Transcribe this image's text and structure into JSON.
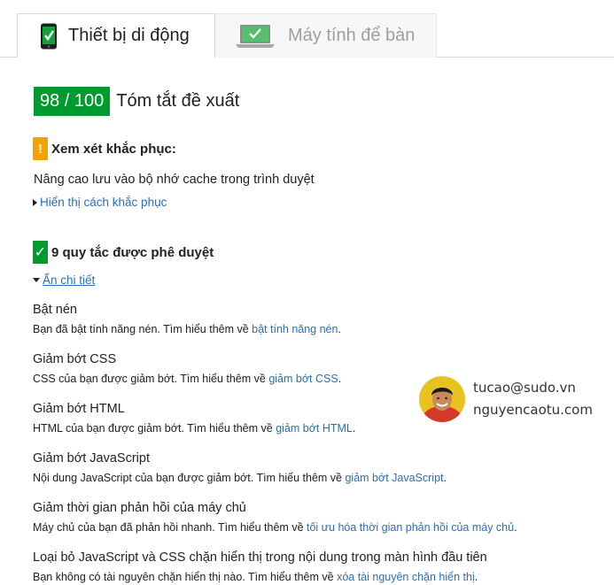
{
  "tabs": {
    "mobile": {
      "label": "Thiết bị di động",
      "icon": "mobile-phone-icon"
    },
    "desktop": {
      "label": "Máy tính để bàn",
      "icon": "laptop-icon"
    }
  },
  "summary": {
    "score": "98 / 100",
    "title": "Tóm tắt đề xuất"
  },
  "consider_fixing": {
    "badge": "!",
    "heading": "Xem xét khắc phục:",
    "item": "Nâng cao lưu vào bộ nhớ cache trong trình duyệt",
    "toggle": "Hiển thị cách khắc phục"
  },
  "passed": {
    "badge": "✓",
    "heading": "9 quy tắc được phê duyệt",
    "toggle": "Ẩn chi tiết",
    "rules": [
      {
        "title": "Bật nén",
        "desc": "Bạn đã bật tính năng nén. Tìm hiểu thêm về ",
        "link": "bật tính năng nén",
        "end": "."
      },
      {
        "title": "Giảm bớt CSS",
        "desc": "CSS của bạn được giảm bớt. Tìm hiểu thêm về ",
        "link": "giảm bớt CSS",
        "end": "."
      },
      {
        "title": "Giảm bớt HTML",
        "desc": "HTML của bạn được giảm bớt. Tìm hiểu thêm về ",
        "link": "giảm bớt HTML",
        "end": "."
      },
      {
        "title": "Giảm bớt JavaScript",
        "desc": "Nội dung JavaScript của bạn được giảm bớt. Tìm hiểu thêm về ",
        "link": "giảm bớt JavaScript",
        "end": "."
      },
      {
        "title": "Giảm thời gian phản hồi của máy chủ",
        "desc": "Máy chủ của bạn đã phản hồi nhanh. Tìm hiểu thêm về ",
        "link": "tối ưu hóa thời gian phản hồi của máy chủ",
        "end": "."
      },
      {
        "title": "Loại bỏ JavaScript và CSS chặn hiển thị trong nội dung trong màn hình đầu tiên",
        "desc": "Bạn không có tài nguyên chặn hiển thị nào. Tìm hiểu thêm về ",
        "link": "xóa tài nguyên chặn hiển thị",
        "end": "."
      }
    ]
  },
  "watermark": {
    "email": "tucao@sudo.vn",
    "site": "nguyencaotu.com"
  },
  "colors": {
    "score_green": "#009a2e",
    "warning_orange": "#f4a300",
    "link_blue": "#2a6ebb"
  }
}
